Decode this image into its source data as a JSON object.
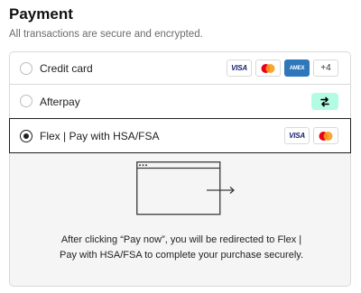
{
  "header": {
    "title": "Payment",
    "subtitle": "All transactions are secure and encrypted."
  },
  "methods": [
    {
      "label": "Credit card",
      "selected": false,
      "badges": [
        {
          "icon": "visa-icon",
          "text": "VISA"
        },
        {
          "icon": "mastercard-icon"
        },
        {
          "icon": "amex-icon",
          "text": "AMEX"
        },
        {
          "icon": "more-cards",
          "text": "+4"
        }
      ]
    },
    {
      "label": "Afterpay",
      "selected": false,
      "badges": [
        {
          "icon": "afterpay-icon"
        }
      ]
    },
    {
      "label": "Flex | Pay with HSA/FSA",
      "selected": true,
      "badges": [
        {
          "icon": "visa-icon",
          "text": "VISA"
        },
        {
          "icon": "mastercard-icon"
        }
      ]
    }
  ],
  "redirect_panel": {
    "icon": "browser-redirect-icon",
    "message": "After clicking “Pay now”, you will be redirected to Flex | Pay with HSA/FSA to complete your purchase securely."
  },
  "colors": {
    "visa": "#1a1f71",
    "mastercard_red": "#eb001b",
    "mastercard_orange": "#f79e1b",
    "amex": "#2e77bb",
    "afterpay": "#b2fce4",
    "selected_border": "#1f1f1f"
  }
}
